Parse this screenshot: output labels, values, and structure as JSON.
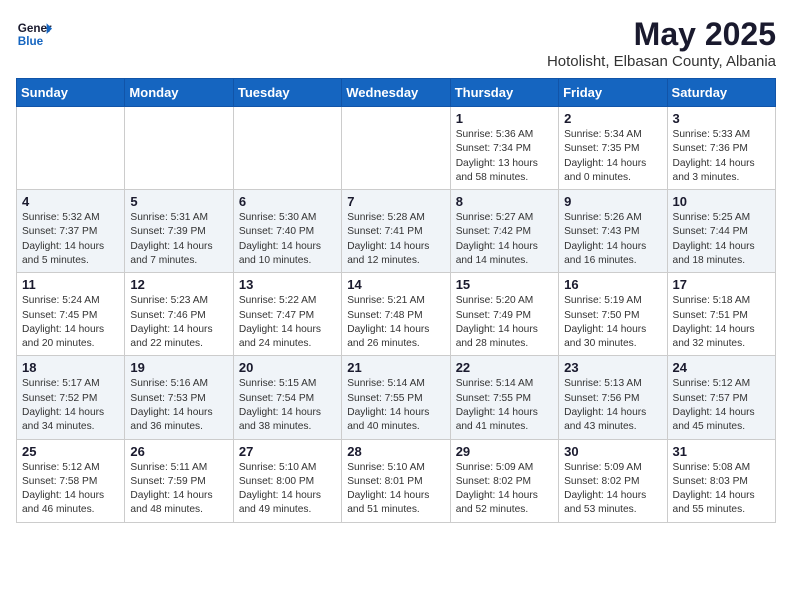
{
  "header": {
    "logo_general": "General",
    "logo_blue": "Blue",
    "month_title": "May 2025",
    "subtitle": "Hotolisht, Elbasan County, Albania"
  },
  "weekdays": [
    "Sunday",
    "Monday",
    "Tuesday",
    "Wednesday",
    "Thursday",
    "Friday",
    "Saturday"
  ],
  "weeks": [
    [
      {
        "day": "",
        "sunrise": "",
        "sunset": "",
        "daylight": ""
      },
      {
        "day": "",
        "sunrise": "",
        "sunset": "",
        "daylight": ""
      },
      {
        "day": "",
        "sunrise": "",
        "sunset": "",
        "daylight": ""
      },
      {
        "day": "",
        "sunrise": "",
        "sunset": "",
        "daylight": ""
      },
      {
        "day": "1",
        "sunrise": "Sunrise: 5:36 AM",
        "sunset": "Sunset: 7:34 PM",
        "daylight": "Daylight: 13 hours and 58 minutes."
      },
      {
        "day": "2",
        "sunrise": "Sunrise: 5:34 AM",
        "sunset": "Sunset: 7:35 PM",
        "daylight": "Daylight: 14 hours and 0 minutes."
      },
      {
        "day": "3",
        "sunrise": "Sunrise: 5:33 AM",
        "sunset": "Sunset: 7:36 PM",
        "daylight": "Daylight: 14 hours and 3 minutes."
      }
    ],
    [
      {
        "day": "4",
        "sunrise": "Sunrise: 5:32 AM",
        "sunset": "Sunset: 7:37 PM",
        "daylight": "Daylight: 14 hours and 5 minutes."
      },
      {
        "day": "5",
        "sunrise": "Sunrise: 5:31 AM",
        "sunset": "Sunset: 7:39 PM",
        "daylight": "Daylight: 14 hours and 7 minutes."
      },
      {
        "day": "6",
        "sunrise": "Sunrise: 5:30 AM",
        "sunset": "Sunset: 7:40 PM",
        "daylight": "Daylight: 14 hours and 10 minutes."
      },
      {
        "day": "7",
        "sunrise": "Sunrise: 5:28 AM",
        "sunset": "Sunset: 7:41 PM",
        "daylight": "Daylight: 14 hours and 12 minutes."
      },
      {
        "day": "8",
        "sunrise": "Sunrise: 5:27 AM",
        "sunset": "Sunset: 7:42 PM",
        "daylight": "Daylight: 14 hours and 14 minutes."
      },
      {
        "day": "9",
        "sunrise": "Sunrise: 5:26 AM",
        "sunset": "Sunset: 7:43 PM",
        "daylight": "Daylight: 14 hours and 16 minutes."
      },
      {
        "day": "10",
        "sunrise": "Sunrise: 5:25 AM",
        "sunset": "Sunset: 7:44 PM",
        "daylight": "Daylight: 14 hours and 18 minutes."
      }
    ],
    [
      {
        "day": "11",
        "sunrise": "Sunrise: 5:24 AM",
        "sunset": "Sunset: 7:45 PM",
        "daylight": "Daylight: 14 hours and 20 minutes."
      },
      {
        "day": "12",
        "sunrise": "Sunrise: 5:23 AM",
        "sunset": "Sunset: 7:46 PM",
        "daylight": "Daylight: 14 hours and 22 minutes."
      },
      {
        "day": "13",
        "sunrise": "Sunrise: 5:22 AM",
        "sunset": "Sunset: 7:47 PM",
        "daylight": "Daylight: 14 hours and 24 minutes."
      },
      {
        "day": "14",
        "sunrise": "Sunrise: 5:21 AM",
        "sunset": "Sunset: 7:48 PM",
        "daylight": "Daylight: 14 hours and 26 minutes."
      },
      {
        "day": "15",
        "sunrise": "Sunrise: 5:20 AM",
        "sunset": "Sunset: 7:49 PM",
        "daylight": "Daylight: 14 hours and 28 minutes."
      },
      {
        "day": "16",
        "sunrise": "Sunrise: 5:19 AM",
        "sunset": "Sunset: 7:50 PM",
        "daylight": "Daylight: 14 hours and 30 minutes."
      },
      {
        "day": "17",
        "sunrise": "Sunrise: 5:18 AM",
        "sunset": "Sunset: 7:51 PM",
        "daylight": "Daylight: 14 hours and 32 minutes."
      }
    ],
    [
      {
        "day": "18",
        "sunrise": "Sunrise: 5:17 AM",
        "sunset": "Sunset: 7:52 PM",
        "daylight": "Daylight: 14 hours and 34 minutes."
      },
      {
        "day": "19",
        "sunrise": "Sunrise: 5:16 AM",
        "sunset": "Sunset: 7:53 PM",
        "daylight": "Daylight: 14 hours and 36 minutes."
      },
      {
        "day": "20",
        "sunrise": "Sunrise: 5:15 AM",
        "sunset": "Sunset: 7:54 PM",
        "daylight": "Daylight: 14 hours and 38 minutes."
      },
      {
        "day": "21",
        "sunrise": "Sunrise: 5:14 AM",
        "sunset": "Sunset: 7:55 PM",
        "daylight": "Daylight: 14 hours and 40 minutes."
      },
      {
        "day": "22",
        "sunrise": "Sunrise: 5:14 AM",
        "sunset": "Sunset: 7:55 PM",
        "daylight": "Daylight: 14 hours and 41 minutes."
      },
      {
        "day": "23",
        "sunrise": "Sunrise: 5:13 AM",
        "sunset": "Sunset: 7:56 PM",
        "daylight": "Daylight: 14 hours and 43 minutes."
      },
      {
        "day": "24",
        "sunrise": "Sunrise: 5:12 AM",
        "sunset": "Sunset: 7:57 PM",
        "daylight": "Daylight: 14 hours and 45 minutes."
      }
    ],
    [
      {
        "day": "25",
        "sunrise": "Sunrise: 5:12 AM",
        "sunset": "Sunset: 7:58 PM",
        "daylight": "Daylight: 14 hours and 46 minutes."
      },
      {
        "day": "26",
        "sunrise": "Sunrise: 5:11 AM",
        "sunset": "Sunset: 7:59 PM",
        "daylight": "Daylight: 14 hours and 48 minutes."
      },
      {
        "day": "27",
        "sunrise": "Sunrise: 5:10 AM",
        "sunset": "Sunset: 8:00 PM",
        "daylight": "Daylight: 14 hours and 49 minutes."
      },
      {
        "day": "28",
        "sunrise": "Sunrise: 5:10 AM",
        "sunset": "Sunset: 8:01 PM",
        "daylight": "Daylight: 14 hours and 51 minutes."
      },
      {
        "day": "29",
        "sunrise": "Sunrise: 5:09 AM",
        "sunset": "Sunset: 8:02 PM",
        "daylight": "Daylight: 14 hours and 52 minutes."
      },
      {
        "day": "30",
        "sunrise": "Sunrise: 5:09 AM",
        "sunset": "Sunset: 8:02 PM",
        "daylight": "Daylight: 14 hours and 53 minutes."
      },
      {
        "day": "31",
        "sunrise": "Sunrise: 5:08 AM",
        "sunset": "Sunset: 8:03 PM",
        "daylight": "Daylight: 14 hours and 55 minutes."
      }
    ]
  ]
}
